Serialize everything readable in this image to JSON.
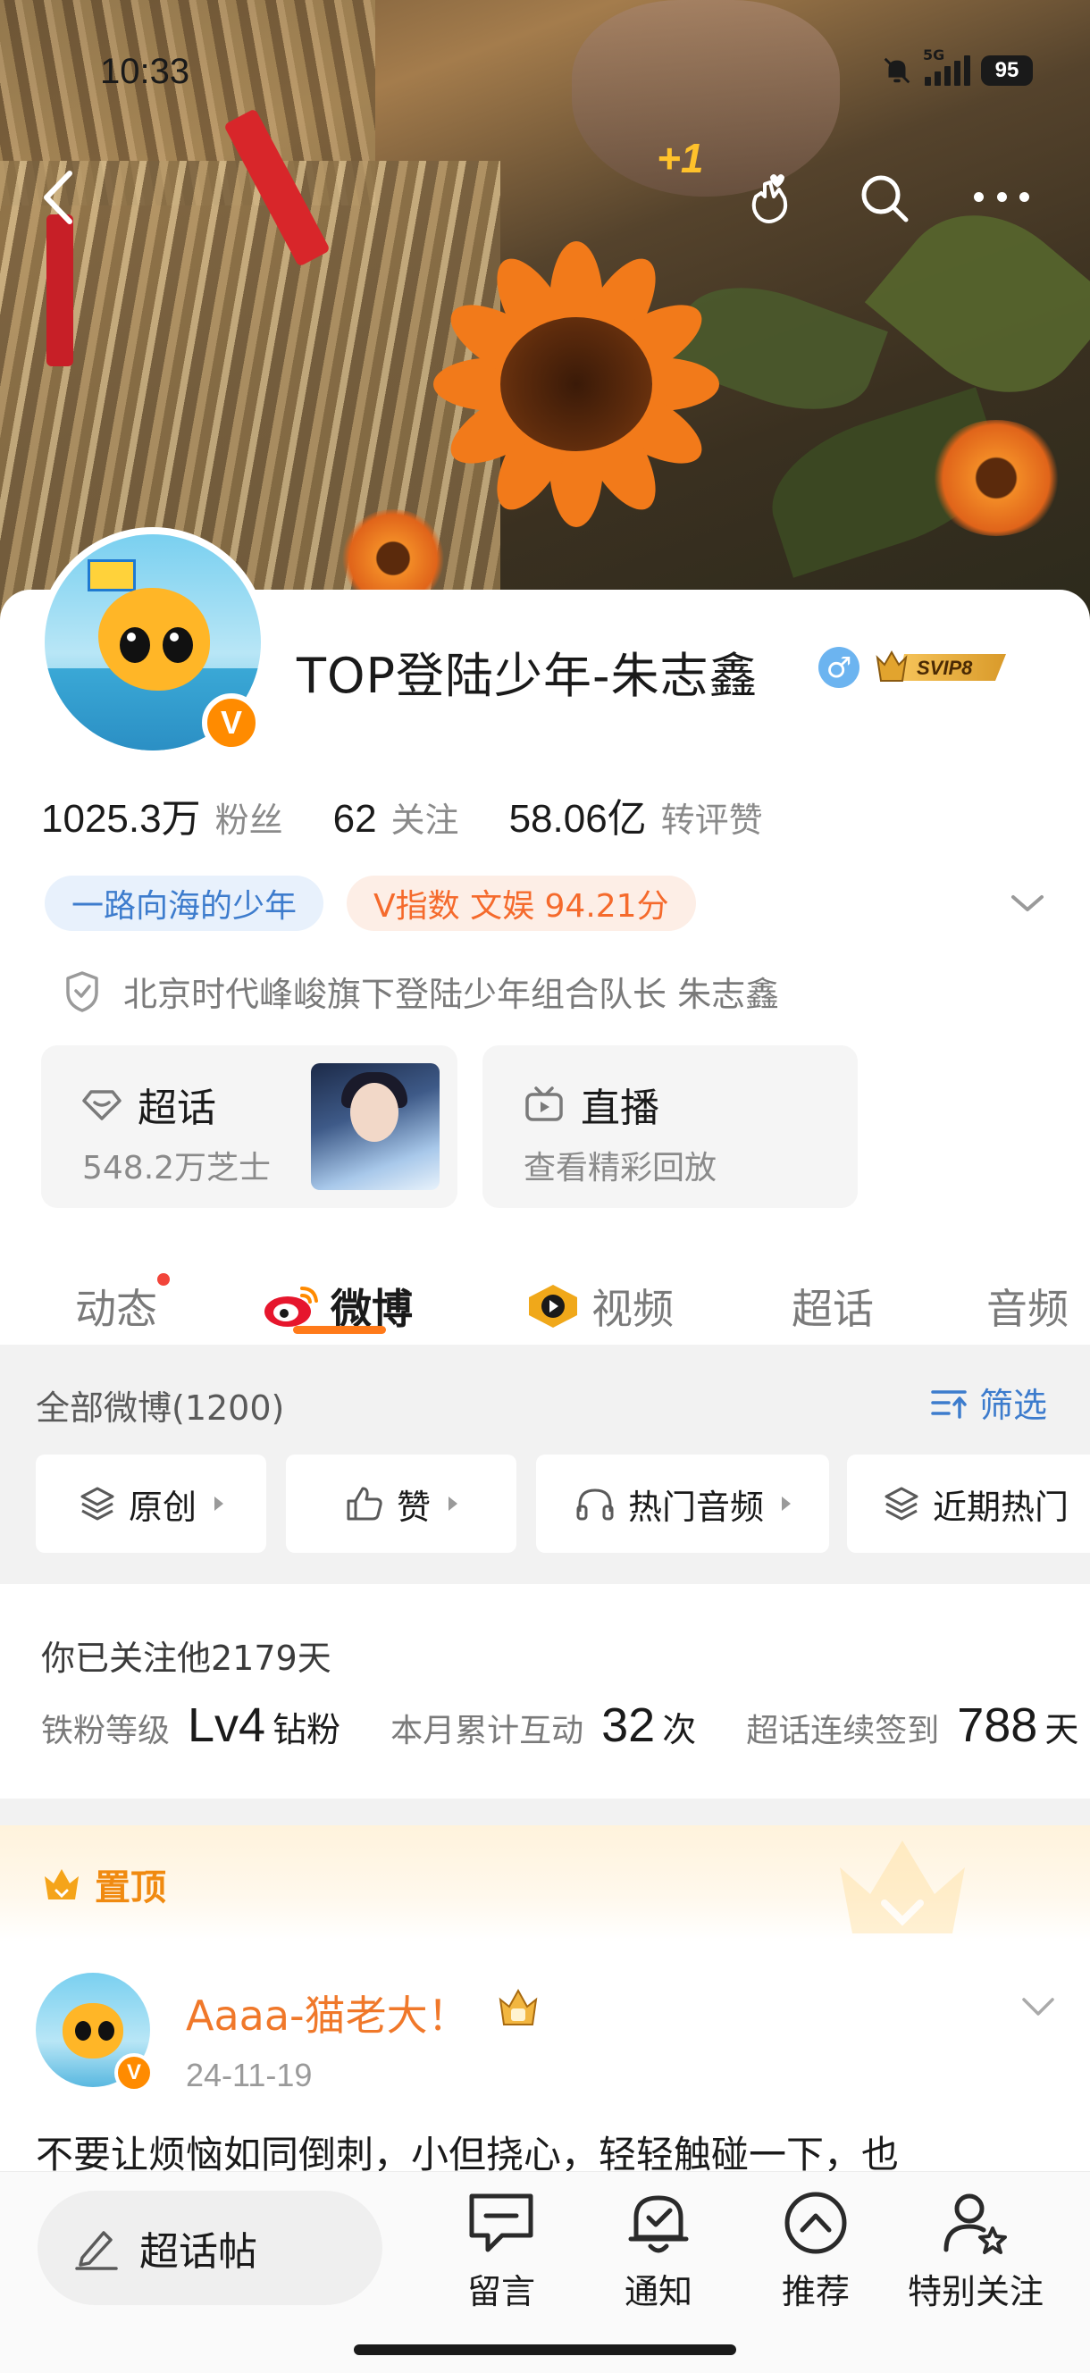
{
  "status_bar": {
    "time": "10:33",
    "network": "5G",
    "battery": "95"
  },
  "header": {
    "like_plus": "+1"
  },
  "profile": {
    "name": "TOP登陆少年-朱志鑫",
    "gender_symbol": "♂",
    "vip_label": "SVIP8",
    "v_badge": "V",
    "stats": [
      {
        "value": "1025.3万",
        "label": "粉丝"
      },
      {
        "value": "62",
        "label": "关注"
      },
      {
        "value": "58.06亿",
        "label": "转评赞"
      }
    ],
    "tags": [
      {
        "text": "一路向海的少年"
      },
      {
        "text": "V指数 文娱 94.21分"
      }
    ],
    "verification": "北京时代峰峻旗下登陆少年组合队长 朱志鑫"
  },
  "tiles": {
    "chaohua": {
      "title": "超话",
      "subtitle": "548.2万芝士"
    },
    "live": {
      "title": "直播",
      "subtitle": "查看精彩回放"
    }
  },
  "tabs": [
    {
      "label": "动态",
      "has_dot": true
    },
    {
      "label": "微博",
      "active": true
    },
    {
      "label": "视频"
    },
    {
      "label": "超话"
    },
    {
      "label": "音频"
    }
  ],
  "feed": {
    "all_label": "全部微博(1200)",
    "filter_label": "筛选",
    "chips": [
      "原创",
      "赞",
      "热门音频",
      "近期热门"
    ]
  },
  "fan_info": {
    "follow_days": "你已关注他2179天",
    "items": [
      {
        "label": "铁粉等级",
        "value": "Lv4",
        "unit": "钻粉"
      },
      {
        "label": "本月累计互动",
        "value": "32",
        "unit": "次"
      },
      {
        "label": "超话连续签到",
        "value": "788",
        "unit": "天"
      }
    ]
  },
  "pinned": {
    "label": "置顶"
  },
  "post": {
    "author": "Aaaa-猫老大！",
    "date": "24-11-19",
    "text": "不要让烦恼如同倒刺，小但挠心，轻轻触碰一下，也"
  },
  "bottom_bar": {
    "compose_label": "超话帖",
    "actions": [
      "留言",
      "通知",
      "推荐",
      "特别关注"
    ]
  },
  "colors": {
    "accent_orange": "#ff7a1a",
    "link_blue": "#3d7ccd",
    "v_orange": "#ff8b00"
  }
}
